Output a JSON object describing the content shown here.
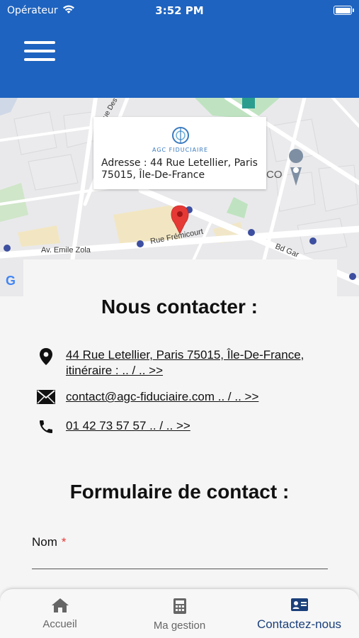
{
  "status_bar": {
    "carrier": "Opérateur",
    "time": "3:52 PM",
    "battery_level": 1.0
  },
  "map": {
    "info_card": {
      "logo_text": "AGC FIDUCIAIRE",
      "address": "Adresse : 44 Rue Letellier, Paris 75015, Île-De-France"
    },
    "labels": {
      "street_1": "Av. Emile Zola",
      "street_2": "Rue Frémicourt",
      "street_3": "Bd Gar",
      "street_4": "ue Des",
      "poi_partial": "CO",
      "google": "G"
    },
    "colors": {
      "marker": "#e53935",
      "poi": "#5a7d9a"
    }
  },
  "contact": {
    "title": "Nous contacter :",
    "address_line1": "44 Rue Letellier, Paris 75015, Île-De-France,",
    "address_line2": "itinéraire : .. / .. >>",
    "email": "contact@agc-fiduciaire.com .. / .. >>",
    "phone": "01 42 73 57 57  .. / .. >>",
    "icons": [
      "location-pin-icon",
      "envelope-icon",
      "phone-icon"
    ]
  },
  "form": {
    "title": "Formulaire de contact :",
    "name_label": "Nom",
    "required_mark": "*"
  },
  "tabbar": {
    "tabs": [
      {
        "label": "Accueil",
        "icon": "home-icon",
        "active": false
      },
      {
        "label": "Ma gestion",
        "icon": "calculator-icon",
        "active": false
      },
      {
        "label": "Contactez-nous",
        "icon": "contact-card-icon",
        "active": true
      }
    ]
  },
  "colors": {
    "header": "#1e63bf",
    "active_tab": "#1a3f7a",
    "required": "#e53935"
  }
}
